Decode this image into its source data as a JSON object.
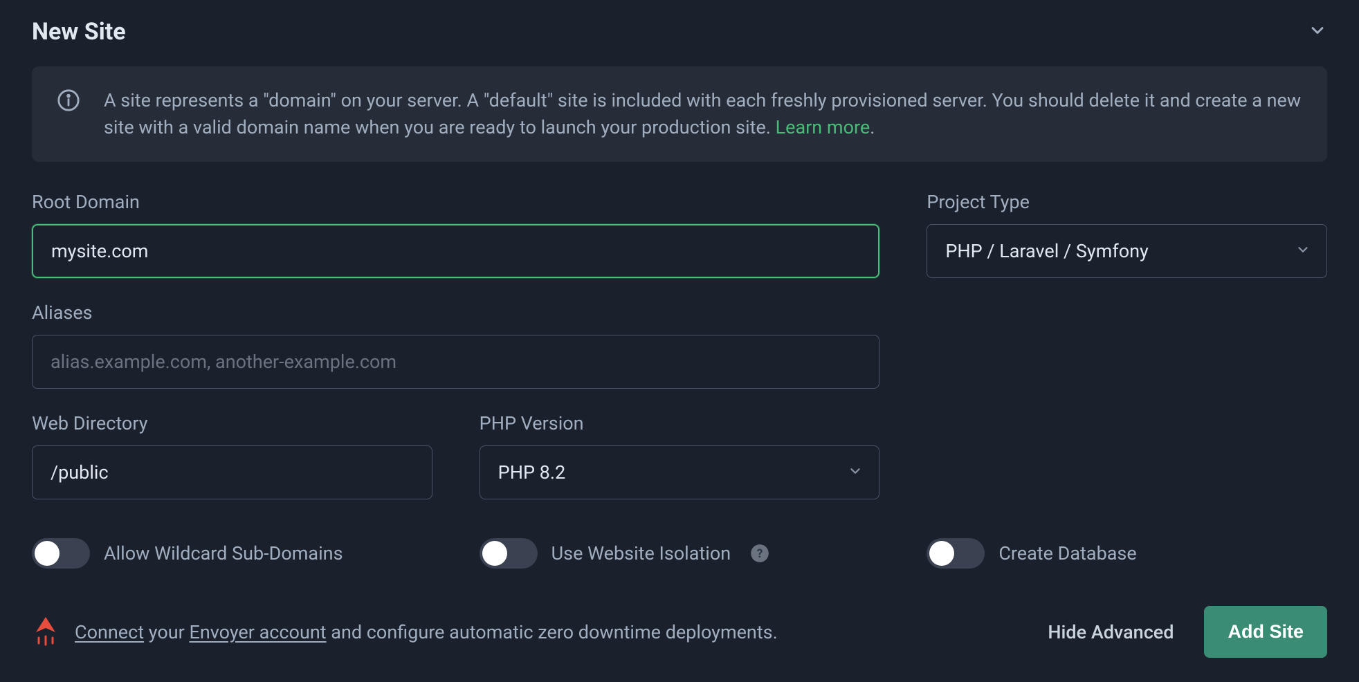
{
  "header": {
    "title": "New Site"
  },
  "info": {
    "text": "A site represents a \"domain\" on your server. A \"default\" site is included with each freshly provisioned server. You should delete it and create a new site with a valid domain name when you are ready to launch your production site. ",
    "learn_more": "Learn more",
    "period": "."
  },
  "form": {
    "root_domain": {
      "label": "Root Domain",
      "value": "mysite.com"
    },
    "project_type": {
      "label": "Project Type",
      "value": "PHP / Laravel / Symfony"
    },
    "aliases": {
      "label": "Aliases",
      "placeholder": "alias.example.com, another-example.com",
      "value": ""
    },
    "web_directory": {
      "label": "Web Directory",
      "value": "/public"
    },
    "php_version": {
      "label": "PHP Version",
      "value": "PHP 8.2"
    }
  },
  "toggles": {
    "wildcard": "Allow Wildcard Sub-Domains",
    "isolation": "Use Website Isolation",
    "database": "Create Database"
  },
  "envoyer": {
    "connect": "Connect",
    "mid1": " your ",
    "account": "Envoyer account",
    "mid2": " and configure automatic zero downtime deployments."
  },
  "actions": {
    "hide_advanced": "Hide Advanced",
    "add_site": "Add Site"
  }
}
